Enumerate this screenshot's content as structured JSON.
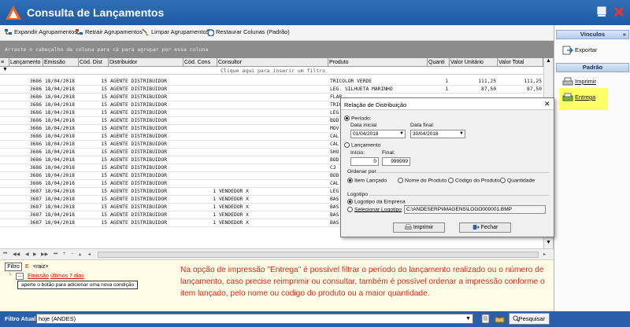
{
  "window": {
    "title": "Consulta de Lançamentos"
  },
  "toolbar": {
    "expand": "Expandir Agrupamentos",
    "collapse": "Retrair Agrupamentos",
    "clear": "Limpar Agrupamentos",
    "restore": "Restaurar Colunas (Padrão)"
  },
  "grid": {
    "group_hint": "Arraste o cabeçalho da coluna para cá para agrupar por essa coluna",
    "filter_hint": "Clique aqui para inserir um filtro",
    "columns": [
      "Lançamento",
      "Emissão",
      "Cód. Dist",
      "Distribuidor",
      "Cód. Cons",
      "Consultor",
      "Produto",
      "Quanti",
      "Valor Unitário",
      "Valor Total"
    ],
    "rows": [
      [
        "3686",
        "18/04/2018",
        "15",
        "AGENTE DISTRIBUIDOR",
        "",
        "",
        "TRICOLOR VERDE",
        "1",
        "111,25",
        "111,25"
      ],
      [
        "3686",
        "18/04/2018",
        "15",
        "AGENTE DISTRIBUIDOR",
        "",
        "",
        "LEG. SILHUETA MARINHO",
        "1",
        "87,50",
        "87,50"
      ],
      [
        "3686",
        "18/04/2018",
        "15",
        "AGENTE DISTRIBUIDOR",
        "",
        "",
        "FLAR",
        "",
        "",
        ""
      ],
      [
        "3686",
        "18/04/2018",
        "15",
        "AGENTE DISTRIBUIDOR",
        "",
        "",
        "TRIC",
        "",
        "",
        ""
      ],
      [
        "3686",
        "18/04/2018",
        "15",
        "AGENTE DISTRIBUIDOR",
        "",
        "",
        "LEG",
        "",
        "",
        ""
      ],
      [
        "3686",
        "18/04/2018",
        "15",
        "AGENTE DISTRIBUIDOR",
        "",
        "",
        "BOD",
        "",
        "",
        ""
      ],
      [
        "3686",
        "18/04/2018",
        "15",
        "AGENTE DISTRIBUIDOR",
        "",
        "",
        "MOV",
        "",
        "",
        ""
      ],
      [
        "3686",
        "18/04/2018",
        "15",
        "AGENTE DISTRIBUIDOR",
        "",
        "",
        "CAL",
        "",
        "",
        ""
      ],
      [
        "3686",
        "18/04/2018",
        "15",
        "AGENTE DISTRIBUIDOR",
        "",
        "",
        "CAL",
        "",
        "",
        ""
      ],
      [
        "3686",
        "18/04/2018",
        "15",
        "AGENTE DISTRIBUIDOR",
        "",
        "",
        "SHO",
        "",
        "",
        ""
      ],
      [
        "3686",
        "18/04/2018",
        "15",
        "AGENTE DISTRIBUIDOR",
        "",
        "",
        "BOD",
        "",
        "",
        ""
      ],
      [
        "3686",
        "18/04/2018",
        "15",
        "AGENTE DISTRIBUIDOR",
        "",
        "",
        "CJ",
        "",
        "",
        ""
      ],
      [
        "3686",
        "18/04/2018",
        "15",
        "AGENTE DISTRIBUIDOR",
        "",
        "",
        "BOD",
        "",
        "",
        ""
      ],
      [
        "3686",
        "18/04/2018",
        "15",
        "AGENTE DISTRIBUIDOR",
        "",
        "",
        "CAL",
        "",
        "",
        ""
      ],
      [
        "3687",
        "18/04/2018",
        "15",
        "AGENTE DISTRIBUIDOR",
        "1",
        "VENDEDOR X",
        "LEG",
        "",
        "",
        ""
      ],
      [
        "3687",
        "18/04/2018",
        "15",
        "AGENTE DISTRIBUIDOR",
        "1",
        "VENDEDOR X",
        "BAS",
        "",
        "",
        ""
      ],
      [
        "3687",
        "18/04/2018",
        "15",
        "AGENTE DISTRIBUIDOR",
        "1",
        "VENDEDOR X",
        "BAS",
        "",
        "",
        ""
      ],
      [
        "3687",
        "18/04/2018",
        "15",
        "AGENTE DISTRIBUIDOR",
        "1",
        "VENDEDOR X",
        "BAS",
        "",
        "",
        ""
      ],
      [
        "3687",
        "18/04/2018",
        "15",
        "AGENTE DISTRIBUIDOR",
        "1",
        "VENDEDOR X",
        "BAS",
        "",
        "",
        ""
      ]
    ]
  },
  "filter": {
    "tab": "Filtro",
    "e": "E",
    "root": "<raiz>",
    "field": "Emissão",
    "condition": "últimos 7 dias",
    "tooltip": "aperte o botão para adicionar uma nova condição"
  },
  "annotation": "Na opção de impressão \"Entrega\" é possível filtrar o período do lançamento realizado ou o número de lançamento, caso precise reimprimir ou consultar, também é possível ordenar a impressão conforme o item lançado, pelo nome ou codigo do produto ou a maior quantidade.",
  "status": {
    "label": "Filtro Atual:",
    "current": "hoje (ANDES)",
    "search": "Pesquisar"
  },
  "side": {
    "vinculos": "Vínculos",
    "exportar": "Exportar",
    "padrao": "Padrão",
    "imprimir": "Imprimir",
    "entrega": "Entrega"
  },
  "dialog": {
    "title": "Relação de Distribuição",
    "periodo": "Período:",
    "data_inicial": "Data inicial",
    "data_final": "Data final",
    "data_inicial_val": "01/04/2018",
    "data_final_val": "30/04/2018",
    "lancamento": "Lançamento",
    "inicio": "Início:",
    "final": "Final:",
    "inicio_val": "0",
    "final_val": "999999",
    "ordenar": "Ordenar por",
    "ord_item": "Item Lançado",
    "ord_nome": "Nome do Produto",
    "ord_codigo": "Código do Produto",
    "ord_qtd": "Quantidade",
    "logotipo": "Logotipo",
    "logo_empresa": "Logotipo da Empresa",
    "logo_selecionar": "Selecionar Logotipo",
    "logo_path": "C:\\ANDESERP\\IMAGENS\\LOGO000001.BMP",
    "imprimir": "Imprimir",
    "fechar": "Fechar"
  },
  "colors": {
    "titlebar": "#1f5aa6",
    "annotation": "#e0261b",
    "highlight": "#ffff66"
  }
}
